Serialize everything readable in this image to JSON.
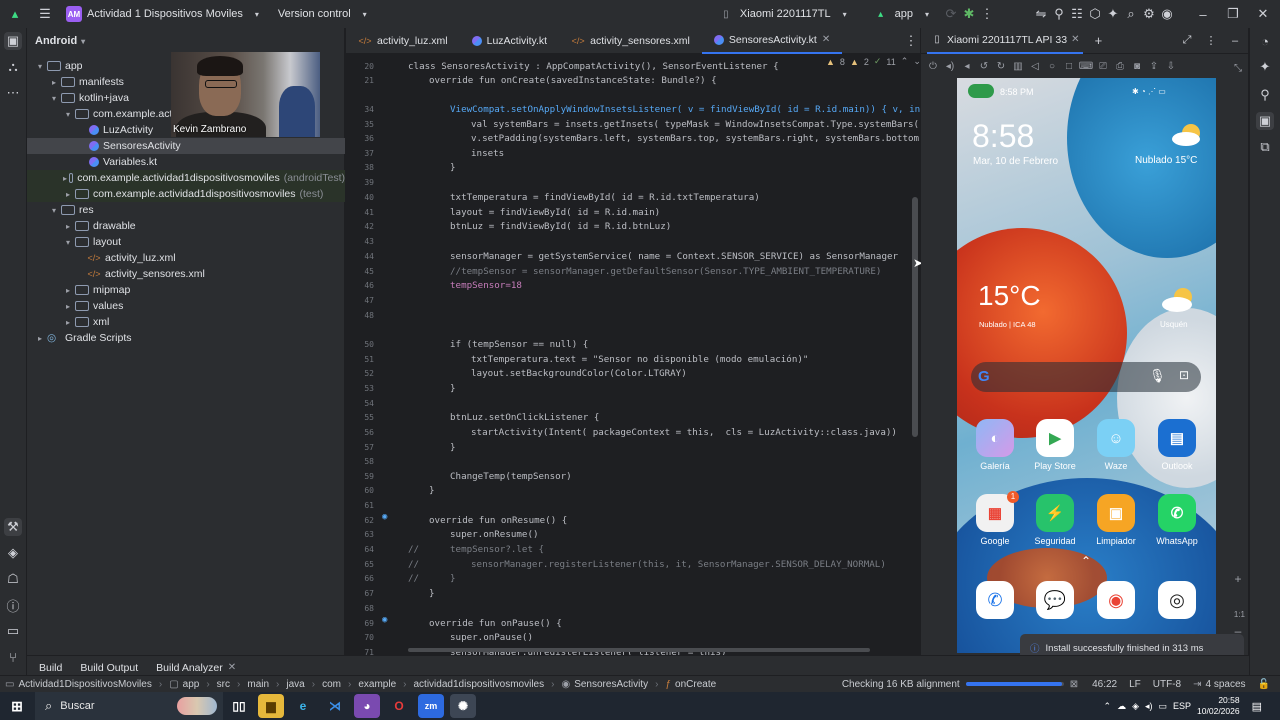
{
  "titlebar": {
    "project_badge": "AM",
    "project_name": "Actividad 1 Dispositivos Moviles",
    "vcs": "Version control",
    "device": "Xiaomi 2201117TL",
    "run_config": "app"
  },
  "project_panel": {
    "title": "Android",
    "tree": [
      {
        "label": "app",
        "extra": ""
      },
      {
        "label": "manifests",
        "extra": ""
      },
      {
        "label": "kotlin+java",
        "extra": ""
      },
      {
        "label": "com.example.activid",
        "extra": ""
      },
      {
        "label": "LuzActivity",
        "extra": ""
      },
      {
        "label": "SensoresActivity",
        "extra": ""
      },
      {
        "label": "Variables.kt",
        "extra": ""
      },
      {
        "label": "com.example.actividad1dispositivosmoviles",
        "extra": "(androidTest)"
      },
      {
        "label": "com.example.actividad1dispositivosmoviles",
        "extra": "(test)"
      },
      {
        "label": "res",
        "extra": ""
      },
      {
        "label": "drawable",
        "extra": ""
      },
      {
        "label": "layout",
        "extra": ""
      },
      {
        "label": "activity_luz.xml",
        "extra": ""
      },
      {
        "label": "activity_sensores.xml",
        "extra": ""
      },
      {
        "label": "mipmap",
        "extra": ""
      },
      {
        "label": "values",
        "extra": ""
      },
      {
        "label": "xml",
        "extra": ""
      },
      {
        "label": "Gradle Scripts",
        "extra": ""
      }
    ]
  },
  "webcam": {
    "name": "Kevin Zambrano"
  },
  "editor_tabs": [
    {
      "label": "activity_luz.xml"
    },
    {
      "label": "LuzActivity.kt"
    },
    {
      "label": "activity_sensores.xml"
    },
    {
      "label": "SensoresActivity.kt"
    }
  ],
  "inspections": {
    "warnings": "8",
    "weak": "2",
    "typos": "11"
  },
  "code_lines": [
    {
      "n": "20",
      "text": "class SensoresActivity : AppCompatActivity(), SensorEventListener {"
    },
    {
      "n": "21",
      "text": "override fun onCreate(savedInstanceState: Bundle?) {"
    },
    {
      "n": "34",
      "text": "ViewCompat.setOnApplyWindowInsetsListener( v = findViewById( id = R.id.main)) { v, insets"
    },
    {
      "n": "35",
      "text": "val systemBars = insets.getInsets( typeMask = WindowInsetsCompat.Type.systemBars())"
    },
    {
      "n": "36",
      "text": "v.setPadding(systemBars.left, systemBars.top, systemBars.right, systemBars.bottom)"
    },
    {
      "n": "37",
      "text": "insets"
    },
    {
      "n": "38",
      "text": "}"
    },
    {
      "n": "39",
      "text": ""
    },
    {
      "n": "40",
      "text": "txtTemperatura = findViewById( id = R.id.txtTemperatura)"
    },
    {
      "n": "41",
      "text": "layout = findViewById( id = R.id.main)"
    },
    {
      "n": "42",
      "text": "btnLuz = findViewById( id = R.id.btnLuz)"
    },
    {
      "n": "43",
      "text": ""
    },
    {
      "n": "44",
      "text": "sensorManager = getSystemService( name = Context.SENSOR_SERVICE) as SensorManager"
    },
    {
      "n": "45",
      "text": "//tempSensor = sensorManager.getDefaultSensor(Sensor.TYPE_AMBIENT_TEMPERATURE)"
    },
    {
      "n": "46",
      "text": "tempSensor=18"
    },
    {
      "n": "47",
      "text": ""
    },
    {
      "n": "48",
      "text": ""
    },
    {
      "n": "50",
      "text": "if (tempSensor == null) {"
    },
    {
      "n": "51",
      "text": "txtTemperatura.text = \"Sensor no disponible (modo emulación)\""
    },
    {
      "n": "52",
      "text": "layout.setBackgroundColor(Color.LTGRAY)"
    },
    {
      "n": "53",
      "text": "}"
    },
    {
      "n": "54",
      "text": ""
    },
    {
      "n": "55",
      "text": "btnLuz.setOnClickListener {"
    },
    {
      "n": "56",
      "text": "startActivity(Intent( packageContext = this,  cls = LuzActivity::class.java))"
    },
    {
      "n": "57",
      "text": "}"
    },
    {
      "n": "58",
      "text": ""
    },
    {
      "n": "59",
      "text": "ChangeTemp(tempSensor)"
    },
    {
      "n": "60",
      "text": "}"
    },
    {
      "n": "61",
      "text": ""
    },
    {
      "n": "62",
      "text": "override fun onResume() {"
    },
    {
      "n": "63",
      "text": "super.onResume()"
    },
    {
      "n": "64",
      "text": "tempSensor?.let {"
    },
    {
      "n": "65",
      "text": "sensorManager.registerListener(this, it, SensorManager.SENSOR_DELAY_NORMAL)"
    },
    {
      "n": "66",
      "text": "}"
    },
    {
      "n": "67",
      "text": "}"
    },
    {
      "n": "68",
      "text": ""
    },
    {
      "n": "69",
      "text": "override fun onPause() {"
    },
    {
      "n": "70",
      "text": "super.onPause()"
    },
    {
      "n": "71",
      "text": "sensorManager.unregisterListener( listener = this)"
    }
  ],
  "emulator": {
    "tab": "Xiaomi 2201117TL API 33",
    "status_time": "8:58 PM",
    "clock": "8:58",
    "date": "Mar, 10 de Febrero",
    "weather_top": "Nublado  15°C",
    "temp": "15°C",
    "temp_sub": "Nublado | ICA 48",
    "usquen": "Usquén",
    "apps_row1": [
      "Galería",
      "Play Store",
      "Waze",
      "Outlook"
    ],
    "apps_row2": [
      "Google",
      "Seguridad",
      "Limpiador",
      "WhatsApp"
    ],
    "google_badge": "1",
    "zoom_label": "1:1"
  },
  "toast": {
    "text": "Install successfully finished in 313 ms"
  },
  "bottom_tabs": [
    "Build",
    "Build Output",
    "Build Analyzer"
  ],
  "statusbar": {
    "crumbs": [
      "Actividad1DispositivosMoviles",
      "app",
      "src",
      "main",
      "java",
      "com",
      "example",
      "actividad1dispositivosmoviles",
      "SensoresActivity",
      "onCreate"
    ],
    "task": "Checking 16 KB alignment",
    "progress": 0.98,
    "position": "46:22",
    "line_sep": "LF",
    "encoding": "UTF-8",
    "indent": "4 spaces"
  },
  "taskbar": {
    "search": "Buscar",
    "lang": "ESP",
    "time": "20:58",
    "date": "10/02/2026"
  }
}
